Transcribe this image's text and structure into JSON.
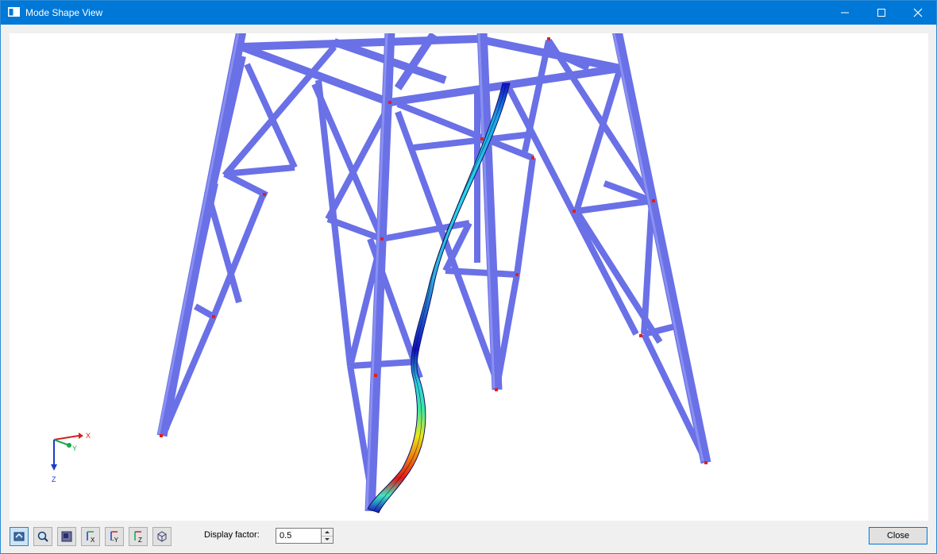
{
  "window": {
    "title": "Mode Shape View"
  },
  "titlebar_buttons": [
    "minimize",
    "maximize",
    "close"
  ],
  "axes": {
    "x": "X",
    "y": "Y",
    "z": "Z"
  },
  "axis_colors": {
    "x": "#d42020",
    "y": "#1aa84a",
    "z": "#1a3cc8"
  },
  "colors": {
    "member": "#6a70e6",
    "member_dark": "#4d52c0",
    "titlebar": "#0078d7"
  },
  "toolbar": {
    "tools": [
      "view-tool-icon",
      "zoom-icon",
      "render-mode-icon",
      "view-x-icon",
      "view-minus-y-icon",
      "view-z-icon",
      "iso-view-icon"
    ],
    "display_factor_label": "Display factor:",
    "display_factor_value": "0.5",
    "close_label": "Close"
  }
}
